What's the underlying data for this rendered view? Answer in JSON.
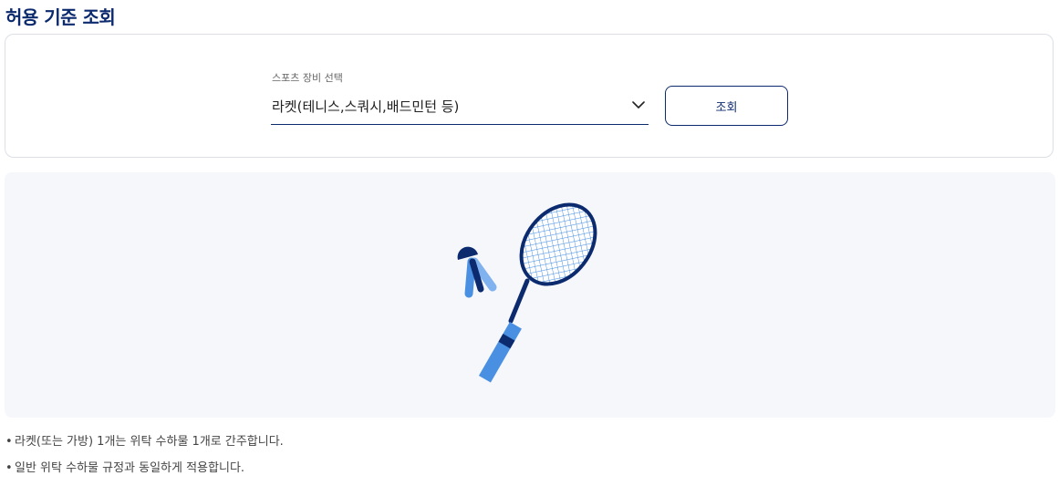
{
  "page": {
    "title": "허용 기준 조회"
  },
  "search": {
    "label": "스포츠 장비 선택",
    "selected": "라켓(테니스,스쿼시,배드민턴 등)",
    "button_label": "조회"
  },
  "illustration": {
    "subject": "racket-and-shuttlecock",
    "colors": {
      "navy": "#0c2a6e",
      "blue": "#4a90e2",
      "light_blue": "#7fb2ef",
      "background": "#f6f7fb"
    }
  },
  "notes": [
    {
      "bullet": "•",
      "text": "라켓(또는 가방) 1개는 위탁 수하물 1개로 간주합니다."
    },
    {
      "bullet": "•",
      "text": "일반 위탁 수하물 규정과 동일하게 적용합니다."
    }
  ]
}
